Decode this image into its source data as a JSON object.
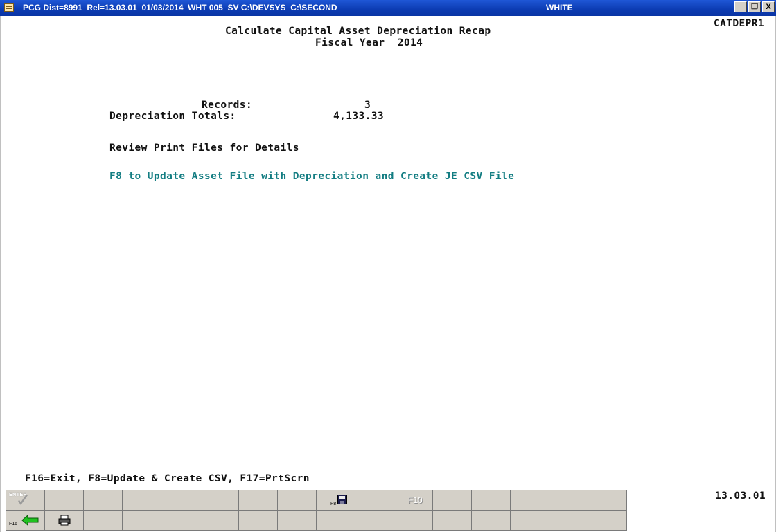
{
  "window": {
    "title": "PCG Dist=8991  Rel=13.03.01  01/03/2014  WHT 005  SV C:\\DEVSYS  C:\\SECOND",
    "user": "WHITE",
    "buttons": {
      "minimize": "_",
      "restore": "Ɖ",
      "close": "X"
    }
  },
  "screen": {
    "program_id": "CATDEPR1",
    "title": "Calculate Capital Asset Depreciation Recap",
    "subtitle": "Fiscal Year  2014",
    "records_label": "Records:",
    "records_value": "3",
    "totals_label": "Depreciation Totals:",
    "totals_value": "4,133.33",
    "review_msg": "Review Print Files for Details",
    "f8_msg": "F8 to Update Asset File with Depreciation and Create JE CSV File",
    "fkey_line": "F16=Exit, F8=Update & Create CSV, F17=PrtScrn",
    "version": "13.03.01"
  },
  "toolbar": {
    "enter_label": "ENTER",
    "f8_label": "F8",
    "f10_label": "F10",
    "f16_label": "F16",
    "colors": {
      "face": "#d4d0c8",
      "arrow": "#1fc21f"
    }
  }
}
